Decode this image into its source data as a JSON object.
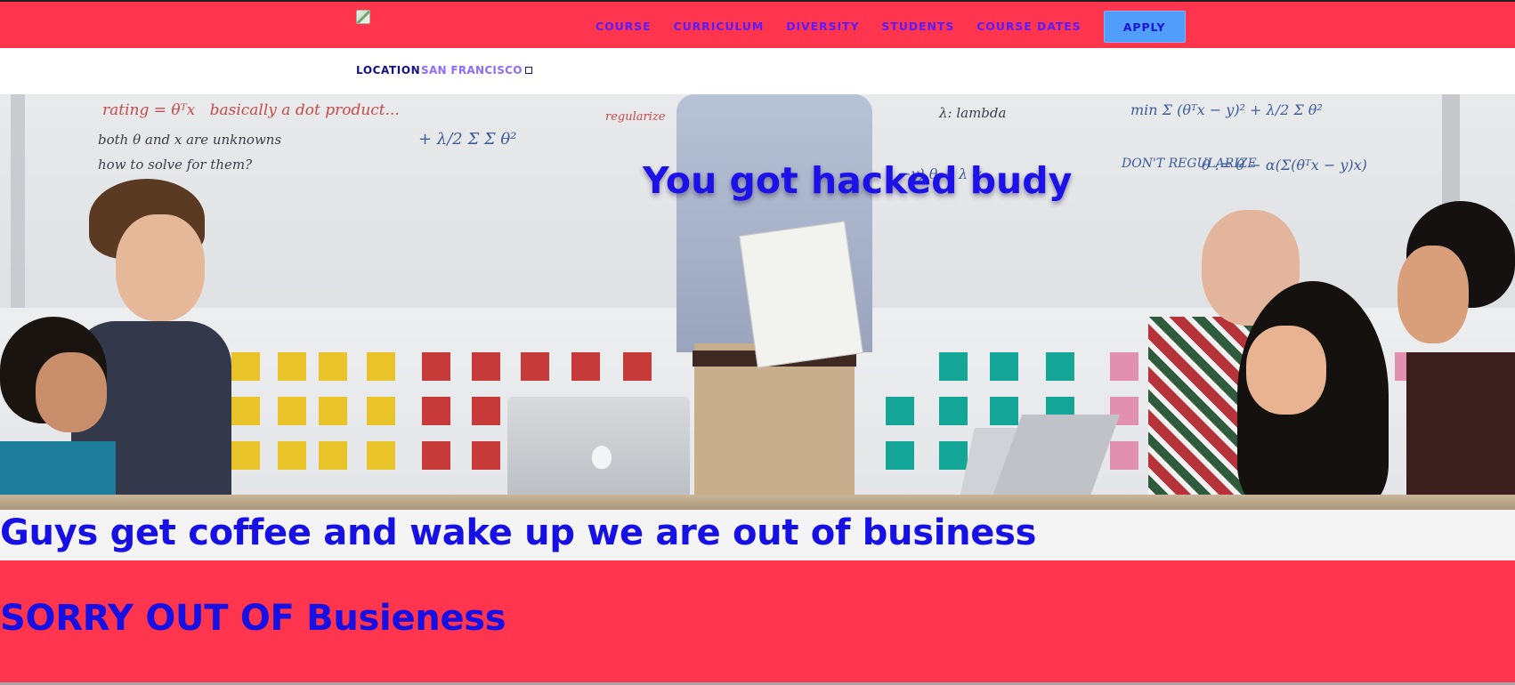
{
  "nav": {
    "items": [
      {
        "label": "COURSE"
      },
      {
        "label": "CURRICULUM"
      },
      {
        "label": "DIVERSITY"
      },
      {
        "label": "STUDENTS"
      },
      {
        "label": "COURSE DATES"
      }
    ],
    "apply_label": "APPLY",
    "logo_icon": "broken-image-icon"
  },
  "location": {
    "label": "LOCATION",
    "value": "SAN FRANCISCO"
  },
  "hero": {
    "title": "You got hacked budy"
  },
  "message": {
    "text": "Guys get coffee and wake up we are out of business"
  },
  "sorry": {
    "text": "SORRY OUT OF Busieness"
  },
  "colors": {
    "brand_red": "#ff344d",
    "heading_blue": "#1710e4",
    "apply_button": "#519dfc",
    "nav_link": "#5a1bff"
  }
}
